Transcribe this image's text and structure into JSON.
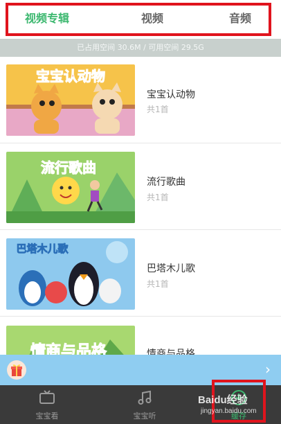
{
  "tabs": {
    "album": "视频专辑",
    "video": "视频",
    "audio": "音频",
    "active": "album"
  },
  "storage_text": "已占用空间 30.6M / 可用空间 29.5G",
  "albums": [
    {
      "title": "宝宝认动物",
      "count": "共1首",
      "thumb_text": "宝宝认动物",
      "thumb_icon": "cartoon-cats-thumbnail"
    },
    {
      "title": "流行歌曲",
      "count": "共1首",
      "thumb_text": "流行歌曲",
      "thumb_icon": "sun-dancing-child-thumbnail"
    },
    {
      "title": "巴塔木儿歌",
      "count": "共1首",
      "thumb_text": "巴塔木儿歌",
      "thumb_icon": "penguins-thumbnail"
    },
    {
      "title": "情商与品格",
      "count": "",
      "thumb_text": "情商与品格",
      "thumb_icon": "mountains-thumbnail"
    }
  ],
  "promo": {
    "icon": "gift-icon",
    "arrow": "›"
  },
  "bottom_nav": [
    {
      "label": "宝宝看",
      "icon": "tv-icon"
    },
    {
      "label": "宝宝听",
      "icon": "music-note-icon"
    },
    {
      "label": "缓存",
      "icon": "download-icon"
    }
  ],
  "watermark": {
    "text": "Baidu经验",
    "url": "jingyan.baidu.com"
  },
  "colors": {
    "accent": "#3cb86f",
    "highlight": "#e0141d",
    "storage_bar": "#c8d0cd",
    "promo_bar": "#8fcdf1",
    "nav_bg": "#3a3a3a"
  }
}
